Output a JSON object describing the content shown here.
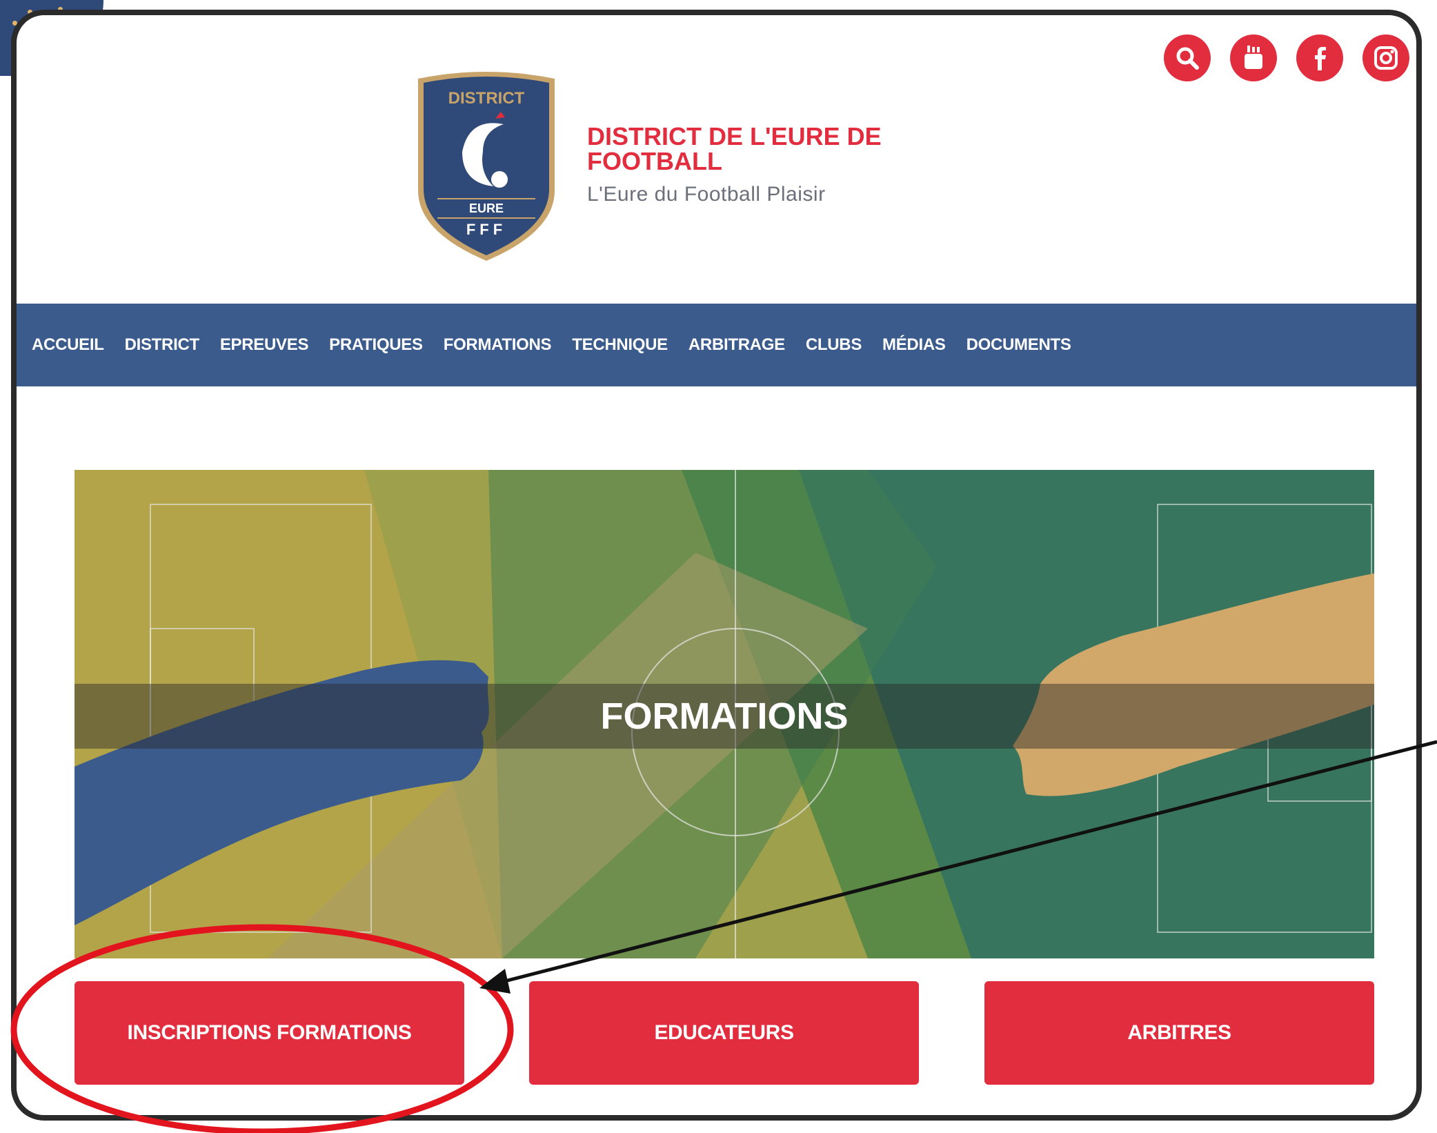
{
  "header": {
    "logo_top_text": "DISTRICT",
    "logo_bottom_text": "EURE",
    "logo_fff_text": "FFF",
    "title": "DISTRICT DE L'EURE DE FOOTBALL",
    "tagline": "L'Eure du Football Plaisir",
    "social_icons": [
      "search-icon",
      "youtube-icon",
      "facebook-icon",
      "instagram-icon"
    ]
  },
  "nav": {
    "items": [
      "ACCUEIL",
      "DISTRICT",
      "EPREUVES",
      "PRATIQUES",
      "FORMATIONS",
      "TECHNIQUE",
      "ARBITRAGE",
      "CLUBS",
      "MÉDIAS",
      "DOCUMENTS"
    ]
  },
  "hero": {
    "title": "FORMATIONS"
  },
  "buttons": {
    "inscriptions": "INSCRIPTIONS FORMATIONS",
    "educateurs": "EDUCATEURS",
    "arbitres": "ARBITRES"
  },
  "colors": {
    "brand_red": "#e22d3f",
    "nav_blue": "#3b5b8c",
    "annotation_red": "#e2141e"
  }
}
